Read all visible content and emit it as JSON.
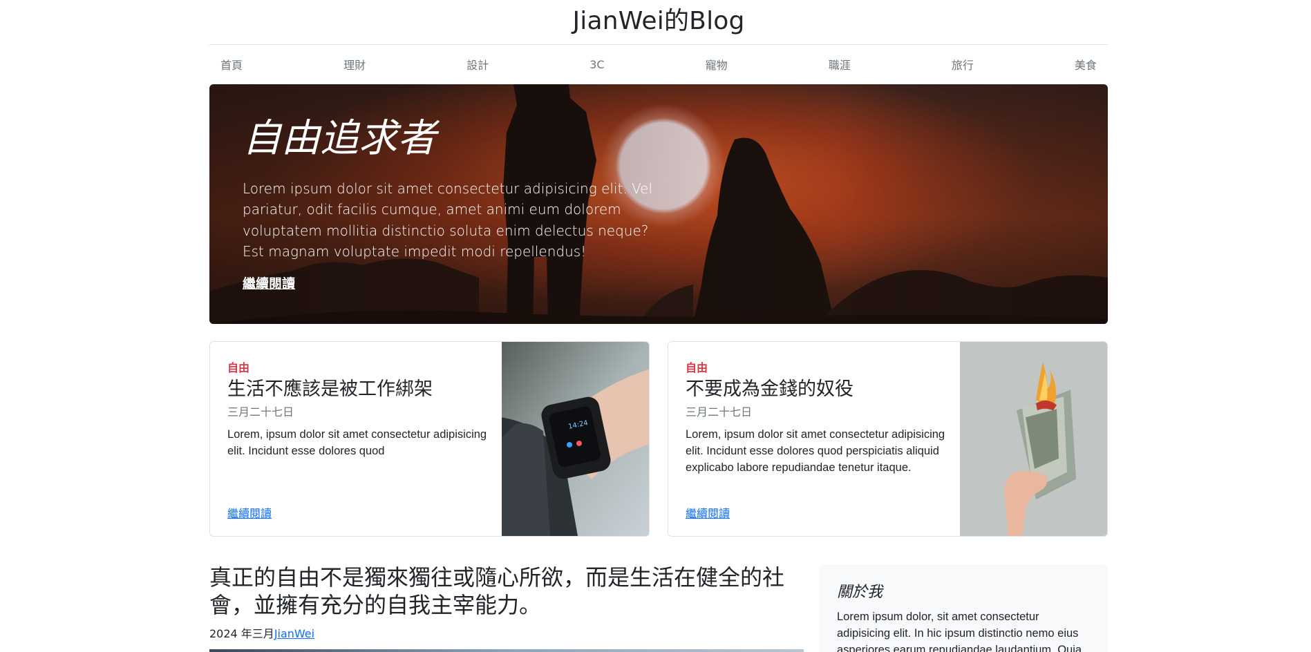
{
  "header": {
    "site_title": "JianWei的Blog"
  },
  "nav": {
    "items": [
      "首頁",
      "理財",
      "設計",
      "3C",
      "寵物",
      "職涯",
      "旅行",
      "美食"
    ]
  },
  "hero": {
    "title": "自由追求者",
    "text": "Lorem ipsum dolor sit amet consectetur adipisicing elit. Vel pariatur, odit facilis cumque, amet animi eum dolorem voluptatem mollitia distinctio soluta enim delectus neque? Est magnam voluptate impedit modi repellendus!",
    "link": "繼續閱讀"
  },
  "cards": [
    {
      "tag": "自由",
      "title": "生活不應該是被工作綁架",
      "date": "三月二十七日",
      "text": "Lorem, ipsum dolor sit amet consectetur adipisicing elit. Incidunt esse dolores quod",
      "link": "繼續閱讀",
      "image": "smartwatch-on-wrist"
    },
    {
      "tag": "自由",
      "title": "不要成為金錢的奴役",
      "date": "三月二十七日",
      "text": "Lorem, ipsum dolor sit amet consectetur adipisicing elit. Incidunt esse dolores quod perspiciatis aliquid explicabo labore repudiandae tenetur itaque.",
      "link": "繼續閱讀",
      "image": "burning-money"
    }
  ],
  "post": {
    "title": "真正的自由不是獨來獨往或隨心所欲，而是生活在健全的社會，並擁有充分的自我主宰能力。",
    "date": "2024 年三月",
    "author": "JianWei"
  },
  "about": {
    "title": "關於我",
    "text": "Lorem ipsum dolor, sit amet consectetur adipisicing elit. In hic ipsum distinctio nemo eius asperiores earum repudiandae laudantium. Quia,"
  },
  "colors": {
    "tag_red": "#dc3545",
    "link_blue": "#0d6efd",
    "nav_gray": "#6c757d"
  }
}
